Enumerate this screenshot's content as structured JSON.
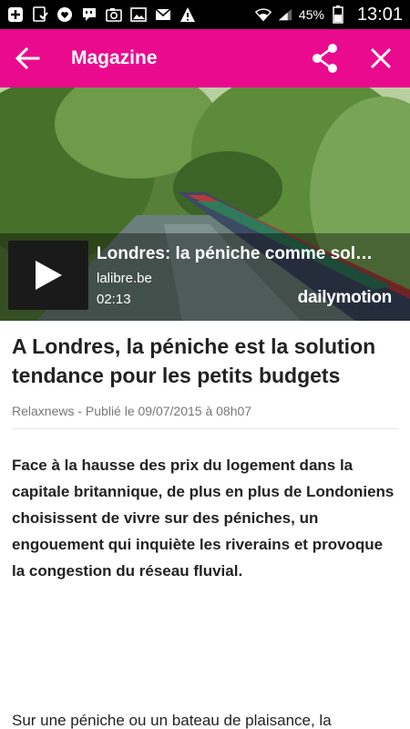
{
  "status_bar": {
    "battery_percent": "45%",
    "time": "13:01",
    "left_icons": [
      "add-icon",
      "download-done-icon",
      "heart-icon",
      "chat-icon",
      "camera-icon",
      "image-icon",
      "mail-icon",
      "warning-icon"
    ],
    "right_icons": [
      "wifi-icon",
      "signal-icon",
      "battery-icon"
    ]
  },
  "app_bar": {
    "title": "Magazine",
    "background_color": "#ea0a8e",
    "icons": [
      "back-arrow-icon",
      "share-icon",
      "close-icon"
    ]
  },
  "video": {
    "title": "Londres: la péniche comme sol…",
    "source": "lalibre.be",
    "duration": "02:13",
    "brand": "dailymotion",
    "icons": [
      "play-icon"
    ]
  },
  "article": {
    "headline": "A Londres, la péniche est la solution tendance pour les petits budgets",
    "meta": "Relaxnews - Publié le 09/07/2015 à 08h07",
    "lead": "Face à la hausse des prix du logement dans la capitale britannique, de plus en plus de Londoniens choisissent de vivre sur des péniches, un engouement qui inquiète les riverains et provoque la congestion du réseau fluvial.",
    "body_start": "Sur une péniche ou un bateau de plaisance, la"
  }
}
